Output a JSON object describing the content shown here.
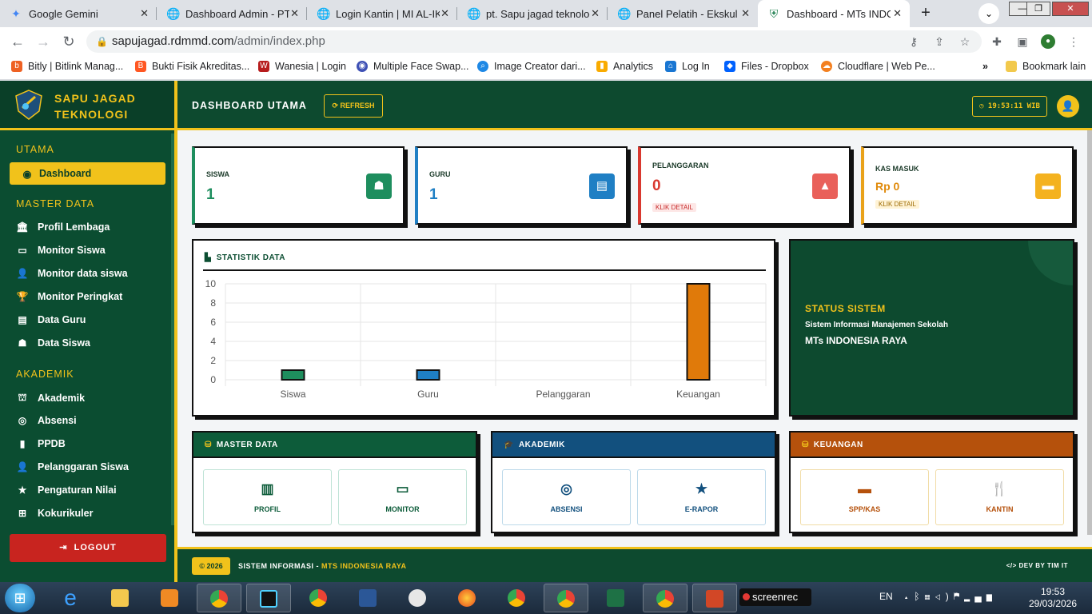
{
  "browser": {
    "tabs": [
      {
        "title": "Google Gemini",
        "icon": "gemini-icon",
        "color": "#4285f4"
      },
      {
        "title": "Dashboard Admin - PT",
        "icon": "globe-icon",
        "color": "#202124"
      },
      {
        "title": "Login Kantin | MI AL-IK",
        "icon": "globe-icon",
        "color": "#202124"
      },
      {
        "title": "pt. Sapu jagad teknolog",
        "icon": "globe-icon",
        "color": "#202124"
      },
      {
        "title": "Panel Pelatih - Ekskul",
        "icon": "globe-icon",
        "color": "#202124"
      },
      {
        "title": "Dashboard - MTs INDO",
        "icon": "shield-icon",
        "color": "#1e7f4f"
      }
    ],
    "url_host": "sapujagad.rdmmd.com",
    "url_path": "/admin/index.php",
    "bookmarks": [
      {
        "label": "Bitly | Bitlink Manag...",
        "color": "#ee6123"
      },
      {
        "label": "Bukti Fisik Akreditas...",
        "color": "#ff5722"
      },
      {
        "label": "Wanesia | Login",
        "color": "#b71c1c"
      },
      {
        "label": "Multiple Face Swap...",
        "color": "#3f51b5"
      },
      {
        "label": "Image Creator dari...",
        "color": "#1e88e5"
      },
      {
        "label": "Analytics",
        "color": "#f9ab00"
      },
      {
        "label": "Log In",
        "color": "#1976d2"
      },
      {
        "label": "Files - Dropbox",
        "color": "#0061fe"
      },
      {
        "label": "Cloudflare | Web Pe...",
        "color": "#f38020"
      }
    ],
    "bookmarks_other": "Bookmark lain"
  },
  "sidebar": {
    "brand_line1": "SAPU JAGAD",
    "brand_line2": "TEKNOLOGI",
    "section_utama": "UTAMA",
    "dashboard": "Dashboard",
    "section_master": "MASTER DATA",
    "master_items": [
      "Profil Lembaga",
      "Monitor Siswa",
      "Monitor data siswa",
      "Monitor Peringkat",
      "Data Guru",
      "Data Siswa"
    ],
    "section_akademik": "AKADEMIK",
    "akademik_items": [
      "Akademik",
      "Absensi",
      "PPDB",
      "Pelanggaran Siswa",
      "Pengaturan Nilai",
      "Kokurikuler"
    ],
    "logout": "LOGOUT"
  },
  "header": {
    "title": "DASHBOARD UTAMA",
    "refresh": "REFRESH",
    "clock": "19:53:11 WIB"
  },
  "stats": {
    "siswa_label": "SISWA",
    "siswa_value": "1",
    "guru_label": "GURU",
    "guru_value": "1",
    "pelanggaran_label": "PELANGGARAN",
    "pelanggaran_value": "0",
    "pelanggaran_badge": "KLIK DETAIL",
    "kas_label": "KAS MASUK",
    "kas_value": "Rp 0",
    "kas_badge": "KLIK DETAIL"
  },
  "chart_title": "STATISTIK DATA",
  "chart_data": {
    "type": "bar",
    "categories": [
      "Siswa",
      "Guru",
      "Pelanggaran",
      "Keuangan"
    ],
    "values": [
      1,
      1,
      0,
      10
    ],
    "colors": [
      "#1e8e5e",
      "#1f7fc4",
      "#d9382f",
      "#e07a0a"
    ],
    "ylim": [
      0,
      10
    ],
    "yticks": [
      0,
      2,
      4,
      6,
      8,
      10
    ],
    "grid": true
  },
  "status": {
    "title": "STATUS SISTEM",
    "subtitle": "Sistem Informasi Manajemen Sekolah",
    "school": "MTs INDONESIA RAYA"
  },
  "modules": {
    "master": {
      "title": "MASTER DATA",
      "btn1": "PROFIL",
      "btn2": "MONITOR",
      "color": "#0d5c3a"
    },
    "akademik": {
      "title": "AKADEMIK",
      "btn1": "ABSENSI",
      "btn2": "E-RAPOR",
      "color": "#12507e"
    },
    "keuangan": {
      "title": "KEUANGAN",
      "btn1": "SPP/KAS",
      "btn2": "KANTIN",
      "color": "#b5510c"
    }
  },
  "footer": {
    "year": "© 2026",
    "text": "SISTEM INFORMASI - ",
    "school": "MTS INDONESIA RAYA",
    "dev": "DEV BY TIM IT"
  },
  "taskbar": {
    "screenrec": "screenrec",
    "lang": "EN",
    "time": "19:53",
    "date": "29/03/2026"
  }
}
